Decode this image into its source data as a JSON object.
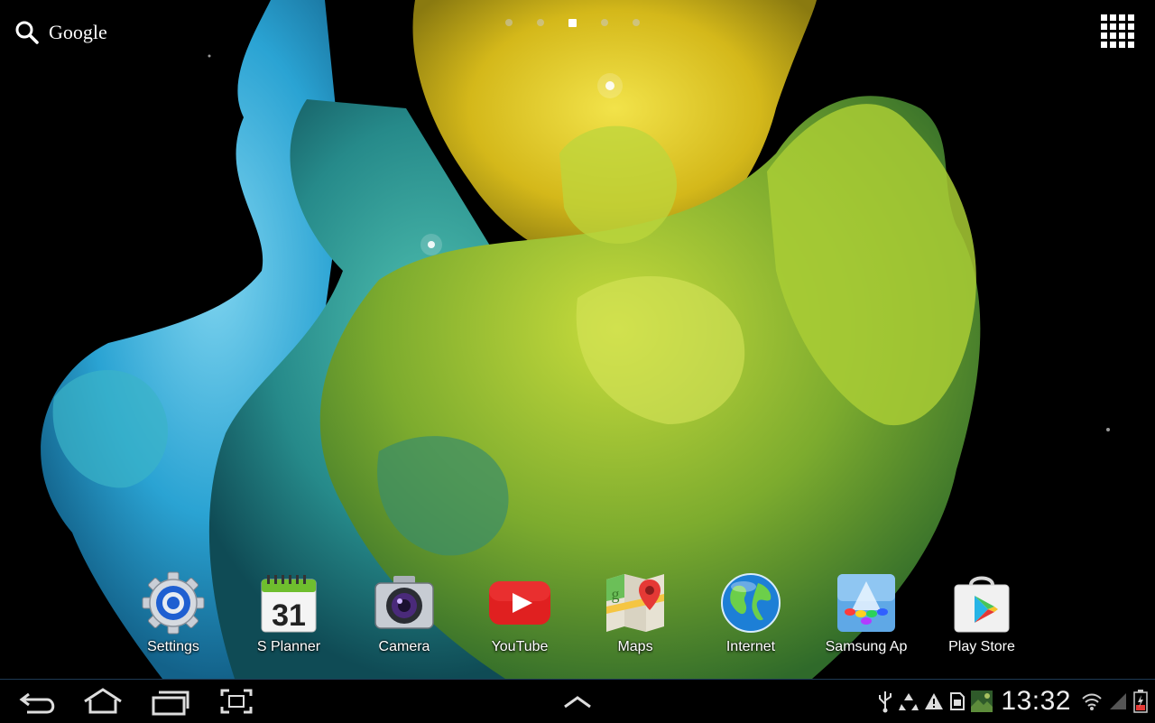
{
  "search": {
    "label": "Google"
  },
  "home_pages": {
    "count": 5,
    "active_index": 2
  },
  "dock": {
    "apps": [
      {
        "label": "Settings",
        "icon": "settings-gear-icon"
      },
      {
        "label": "S Planner",
        "icon": "calendar-icon",
        "day": "31"
      },
      {
        "label": "Camera",
        "icon": "camera-icon"
      },
      {
        "label": "YouTube",
        "icon": "youtube-icon"
      },
      {
        "label": "Maps",
        "icon": "maps-icon"
      },
      {
        "label": "Internet",
        "icon": "globe-icon"
      },
      {
        "label": "Samsung Ap",
        "icon": "samsung-apps-icon"
      },
      {
        "label": "Play Store",
        "icon": "play-store-icon"
      }
    ]
  },
  "status_bar": {
    "time": "13:32",
    "icons": [
      "usb-icon",
      "recycle-icon",
      "warning-icon",
      "sim-card-icon",
      "photo-thumbnail-icon",
      "wifi-icon",
      "signal-icon",
      "battery-icon"
    ],
    "battery_color": "#e53935"
  },
  "nav": {
    "buttons": [
      "back-icon",
      "home-icon",
      "recent-apps-icon",
      "screenshot-icon",
      "expand-up-icon"
    ]
  },
  "colors": {
    "background": "#000000",
    "wallpaper_yellow": "#d4c41a",
    "wallpaper_green": "#4f9e3a",
    "wallpaper_cyan": "#27a9d6"
  }
}
